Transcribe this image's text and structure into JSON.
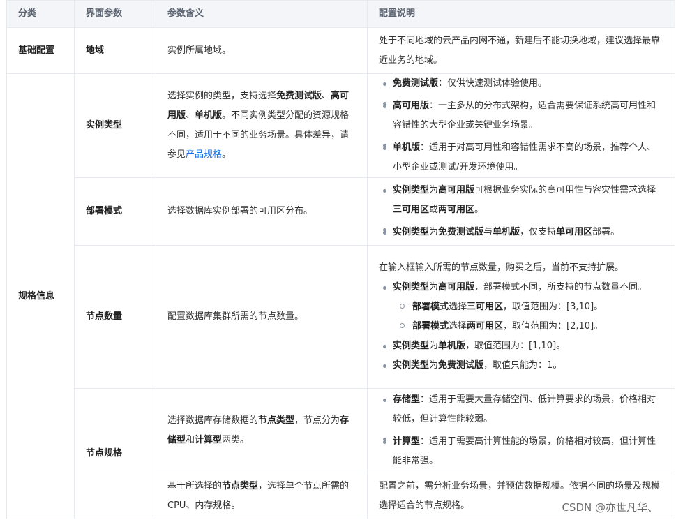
{
  "header": {
    "c1": "分类",
    "c2": "界面参数",
    "c3": "参数含义",
    "c4": "配置说明"
  },
  "rows": {
    "region": {
      "category": "基础配置",
      "param": "地域",
      "meaning": "实例所属地域。",
      "desc": "处于不同地域的云产品内网不通，新建后不能切换地域，建议选择最靠近业务的地域。"
    },
    "spec_category": "规格信息",
    "instance_type": {
      "param": "实例类型",
      "meaning_1": "选择实例的类型，支持选择",
      "meaning_b1": "免费测试版",
      "meaning_2": "、",
      "meaning_b2": "高可用版",
      "meaning_3": "、",
      "meaning_b3": "单机版",
      "meaning_4": "。不同实例类型分配的资源规格不同，适用于不同的业务场景。具体差异，请参见",
      "meaning_link": "产品规格",
      "meaning_5": "。",
      "bullets": [
        {
          "b": "免费测试版",
          "t": "：仅供快速测试体验使用。"
        },
        {
          "b": "高可用版",
          "t": "：一主多从的分布式架构，适合需要保证系统高可用性和容错性的大型企业或关键业务场景。"
        },
        {
          "b": "单机版",
          "t": "：适用于对高可用性和容错性需求不高的场景，推荐个人、小型企业或测试/开发环境使用。"
        }
      ]
    },
    "deploy_mode": {
      "param": "部署模式",
      "meaning": "选择数据库实例部署的可用区分布。",
      "bullet1": {
        "b1": "实例类型",
        "t1": "为",
        "b2": "高可用版",
        "t2": "可根据业务实际的高可用性与容灾性需求选择",
        "b3": "三可用区",
        "t3": "或",
        "b4": "两可用区",
        "t4": "。"
      },
      "bullet2": {
        "b1": "实例类型",
        "t1": "为",
        "b2": "免费测试版",
        "t2": "与",
        "b3": "单机版",
        "t3": "，仅支持",
        "b4": "单可用区",
        "t4": "部署。"
      }
    },
    "node_count": {
      "param": "节点数量",
      "meaning": "配置数据库集群所需的节点数量。",
      "intro": "在输入框输入所需的节点数量，购买之后，当前不支持扩展。",
      "ha": {
        "b1": "实例类型",
        "t1": "为",
        "b2": "高可用版",
        "t2": "，部署模式不同，所支持的节点数量不同。"
      },
      "sub1": {
        "b1": "部署模式",
        "t1": "选择",
        "b2": "三可用区",
        "t2": "，取值范围为：[3,10]。"
      },
      "sub2": {
        "b1": "部署模式",
        "t1": "选择",
        "b2": "两可用区",
        "t2": "，取值范围为：[2,10]。"
      },
      "single": {
        "b1": "实例类型",
        "t1": "为",
        "b2": "单机版",
        "t2": "，取值范围为：[1,10]。"
      },
      "free": {
        "b1": "实例类型",
        "t1": "为",
        "b2": "免费测试版",
        "t2": "，取值只能为：1。"
      }
    },
    "node_spec": {
      "param": "节点规格",
      "meaning_a1": "选择数据库存储数据的",
      "meaning_ab1": "节点类型",
      "meaning_a2": "，节点分为",
      "meaning_ab2": "存储型",
      "meaning_a3": "和",
      "meaning_ab3": "计算型",
      "meaning_a4": "两类。",
      "bullets": [
        {
          "b": "存储型",
          "t": "：适用于需要大量存储空间、低计算要求的场景，价格相对较低，但计算性能较弱。"
        },
        {
          "b": "计算型",
          "t": "：适用于需要高计算性能的场景，价格相对较高，但计算性能非常强。"
        }
      ],
      "meaning_b1": "基于所选择的",
      "meaning_bb1": "节点类型",
      "meaning_b2": "，选择单个节点所需的 CPU、内存规格。",
      "desc_b": "配置之前，需分析业务场景，并预估数据规模。依据不同的场景及规模选择适合的节点规格。"
    }
  },
  "watermark": "CSDN @亦世凡华、"
}
